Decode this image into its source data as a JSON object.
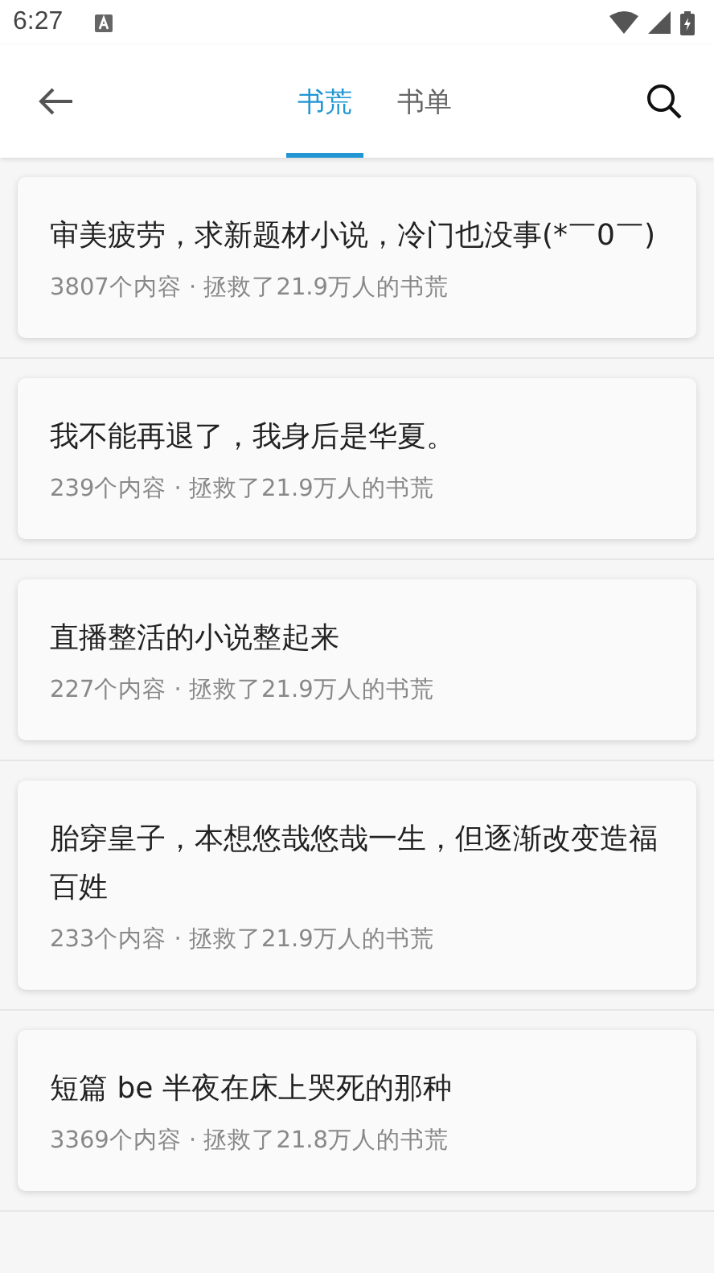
{
  "status_bar": {
    "time": "6:27"
  },
  "tabs": [
    {
      "label": "书荒",
      "selected": true
    },
    {
      "label": "书单",
      "selected": false
    }
  ],
  "cards": [
    {
      "title": "审美疲劳，求新题材小说，冷门也没事(*￣0￣)",
      "meta": "3807个内容 · 拯救了21.9万人的书荒"
    },
    {
      "title": "我不能再退了，我身后是华夏。",
      "meta": "239个内容 · 拯救了21.9万人的书荒"
    },
    {
      "title": "直播整活的小说整起来",
      "meta": "227个内容 · 拯救了21.9万人的书荒"
    },
    {
      "title": "胎穿皇子，本想悠哉悠哉一生，但逐渐改变造福百姓",
      "meta": "233个内容 · 拯救了21.9万人的书荒"
    },
    {
      "title": "短篇 be 半夜在床上哭死的那种",
      "meta": "3369个内容 · 拯救了21.8万人的书荒"
    }
  ]
}
